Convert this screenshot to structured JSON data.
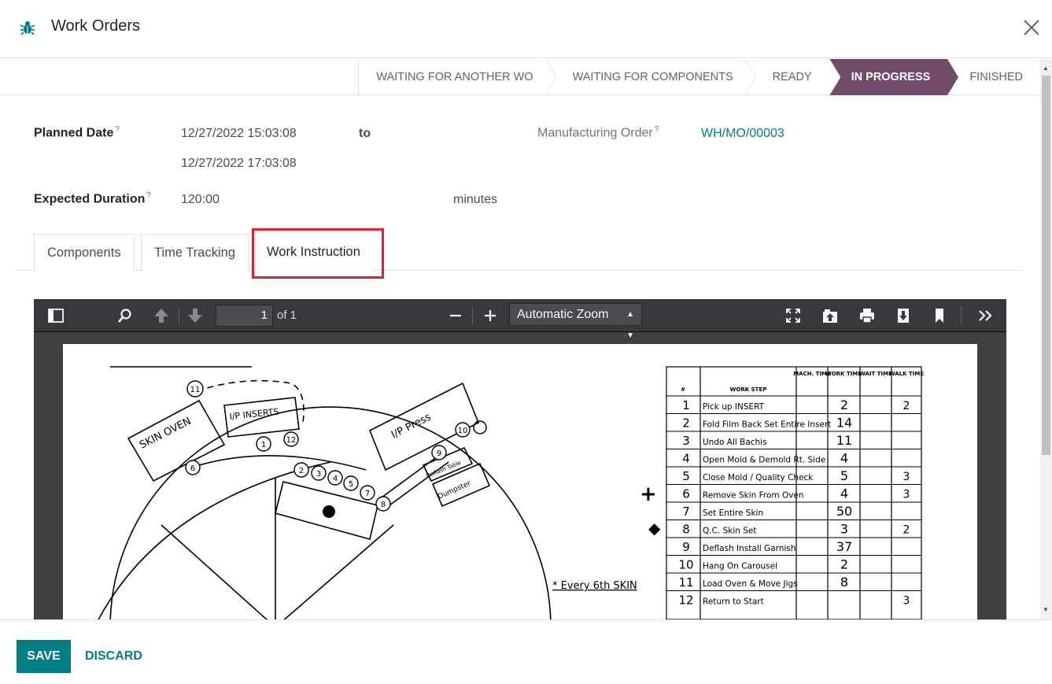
{
  "dialog": {
    "title": "Work Orders",
    "app_icon": "bug-icon",
    "close_icon": "close-icon"
  },
  "stages": [
    {
      "label": "WAITING FOR ANOTHER WO",
      "active": false
    },
    {
      "label": "WAITING FOR COMPONENTS",
      "active": false
    },
    {
      "label": "READY",
      "active": false
    },
    {
      "label": "IN PROGRESS",
      "active": true
    },
    {
      "label": "FINISHED",
      "active": false
    }
  ],
  "form": {
    "planned_date_label": "Planned Date",
    "help_mark": "?",
    "planned_start": "12/27/2022 15:03:08",
    "to_label": "to",
    "planned_end": "12/27/2022 17:03:08",
    "manufacturing_order_label": "Manufacturing Order",
    "manufacturing_order": "WH/MO/00003",
    "expected_duration_label": "Expected Duration",
    "expected_duration": "120:00",
    "duration_unit": "minutes"
  },
  "tabs": [
    {
      "label": "Components"
    },
    {
      "label": "Time Tracking"
    },
    {
      "label": "Work Instruction",
      "active": true
    }
  ],
  "pdf_viewer": {
    "page_number": "1",
    "page_count_label": "of 1",
    "zoom": "Automatic Zoom",
    "document": {
      "diagram_labels": [
        "SKIN OVEN",
        "I/P INSERTS",
        "I/P Press",
        "Deflash Table",
        "Dumpster"
      ],
      "station_numbers": [
        "1",
        "2",
        "3",
        "4",
        "5",
        "6",
        "7",
        "8",
        "9",
        "10",
        "11",
        "12"
      ],
      "note": "* Every 6th SKIN",
      "table_headers": [
        "#",
        "WORK STEP",
        "MACH. TIME",
        "WORK TIME",
        "WAIT TIME",
        "WALK TIME"
      ],
      "steps": [
        {
          "n": "1",
          "step": "Pick up INSERT",
          "work": "2",
          "walk": "2"
        },
        {
          "n": "2",
          "step": "Fold Film Back Set Entire Insert",
          "work": "14",
          "walk": ""
        },
        {
          "n": "3",
          "step": "Undo All Bachis",
          "work": "11",
          "walk": ""
        },
        {
          "n": "4",
          "step": "Open Mold & Demold Rt. Side",
          "work": "4",
          "walk": ""
        },
        {
          "n": "5",
          "step": "Close Mold / Quality Check",
          "work": "5",
          "walk": "3"
        },
        {
          "n": "6",
          "step": "Remove Skin From Oven",
          "work": "4",
          "walk": "3"
        },
        {
          "n": "7",
          "step": "Set Entire Skin",
          "work": "50",
          "walk": ""
        },
        {
          "n": "8",
          "step": "Q.C. Skin Set",
          "work": "3",
          "walk": "2"
        },
        {
          "n": "9",
          "step": "Deflash Install Garnish",
          "work": "37",
          "walk": ""
        },
        {
          "n": "10",
          "step": "Hang On Carousel",
          "work": "2",
          "walk": ""
        },
        {
          "n": "11",
          "step": "Load Oven & Move Jigs",
          "work": "8",
          "walk": ""
        },
        {
          "n": "12",
          "step": "Return to Start",
          "work": "",
          "walk": "3"
        }
      ]
    }
  },
  "footer": {
    "save_label": "SAVE",
    "discard_label": "DISCARD"
  },
  "colors": {
    "accent": "#714b67",
    "primary": "#017e84",
    "highlight": "#e3202a"
  }
}
